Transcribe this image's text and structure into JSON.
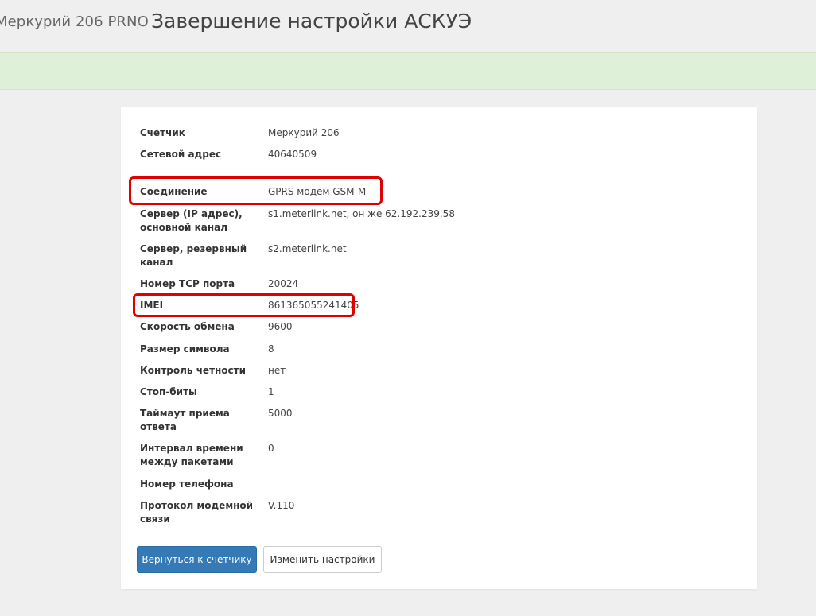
{
  "header": {
    "breadcrumb": "Меркурий 206 PRNO",
    "separator": "/",
    "title": "Завершение настройки АСКУЭ"
  },
  "details": [
    {
      "label": "Счетчик",
      "value": "Меркурий 206"
    },
    {
      "label": "Сетевой адрес",
      "value": "40640509"
    },
    {
      "label": "Соединение",
      "value": "GPRS модем GSM-M"
    },
    {
      "label": "Сервер (IP адрес), основной канал",
      "value": "s1.meterlink.net, он же 62.192.239.58"
    },
    {
      "label": "Сервер, резервный канал",
      "value": "s2.meterlink.net"
    },
    {
      "label": "Номер TCP порта",
      "value": "20024"
    },
    {
      "label": "IMEI",
      "value": "861365055241405"
    },
    {
      "label": "Скорость обмена",
      "value": "9600"
    },
    {
      "label": "Размер символа",
      "value": "8"
    },
    {
      "label": "Контроль четности",
      "value": "нет"
    },
    {
      "label": "Стоп-биты",
      "value": "1"
    },
    {
      "label": "Таймаут приема ответа",
      "value": "5000"
    },
    {
      "label": "Интервал времени между пакетами",
      "value": "0"
    },
    {
      "label": "Номер телефона",
      "value": ""
    },
    {
      "label": "Протокол модемной связи",
      "value": "V.110"
    }
  ],
  "buttons": {
    "back": "Вернуться к счетчику",
    "change": "Изменить настройки"
  },
  "colors": {
    "highlight": "#e00000",
    "primary": "#337ab7",
    "alert_bg": "#dff0d8"
  }
}
